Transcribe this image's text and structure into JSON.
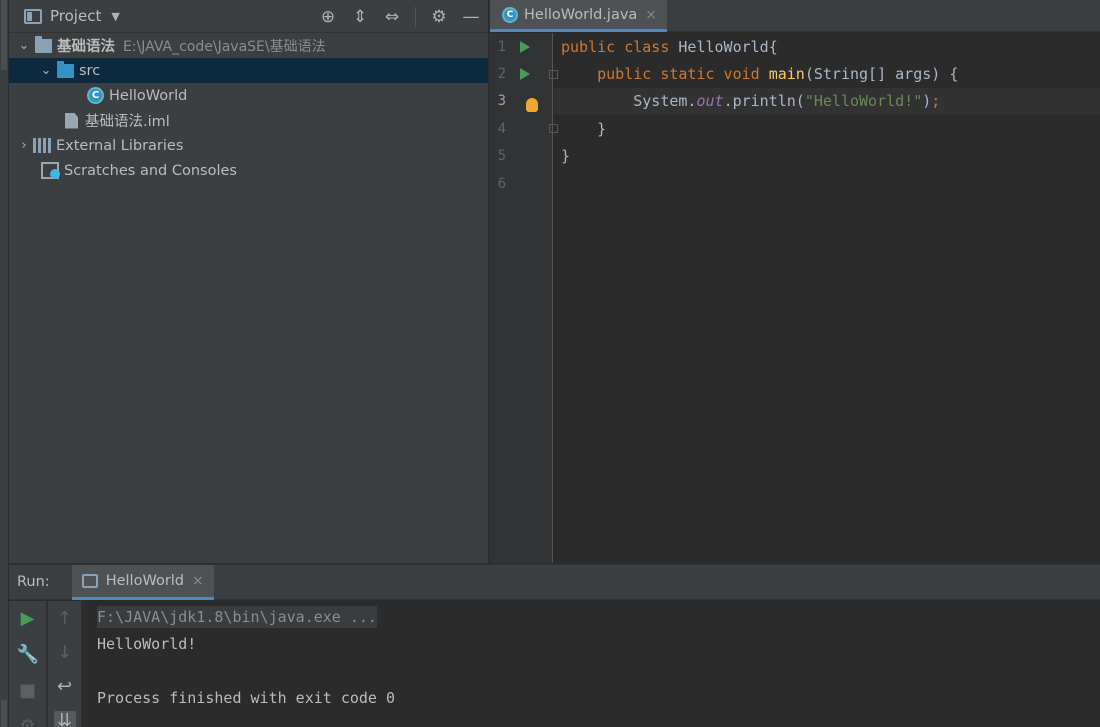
{
  "project_panel": {
    "title": "Project",
    "tree": [
      {
        "label": "基础语法",
        "hint": "E:\\JAVA_code\\JavaSE\\基础语法"
      },
      {
        "label": "src"
      },
      {
        "label": "HelloWorld"
      },
      {
        "label": "基础语法.iml"
      },
      {
        "label": "External Libraries"
      },
      {
        "label": "Scratches and Consoles"
      }
    ]
  },
  "editor": {
    "tab_label": "HelloWorld.java",
    "line_numbers": [
      "1",
      "2",
      "3",
      "4",
      "5",
      "6"
    ],
    "code": {
      "l1_kw": "public class ",
      "l1_rest": "HelloWorld{",
      "l2_indent": "    ",
      "l2_kw": "public static void ",
      "l2_fn": "main",
      "l2_rest": "(String[] args) {",
      "l3_indent": "        ",
      "l3_a": "System.",
      "l3_field": "out",
      "l3_b": ".println(",
      "l3_str": "\"HelloWorld!\"",
      "l3_c": ")",
      "l3_semi": ";",
      "l4": "    }",
      "l5": "}",
      "l6": ""
    }
  },
  "run_panel": {
    "label": "Run:",
    "tab_label": "HelloWorld",
    "console": [
      "F:\\JAVA\\jdk1.8\\bin\\java.exe ...",
      "HelloWorld!",
      "",
      "Process finished with exit code 0"
    ]
  }
}
